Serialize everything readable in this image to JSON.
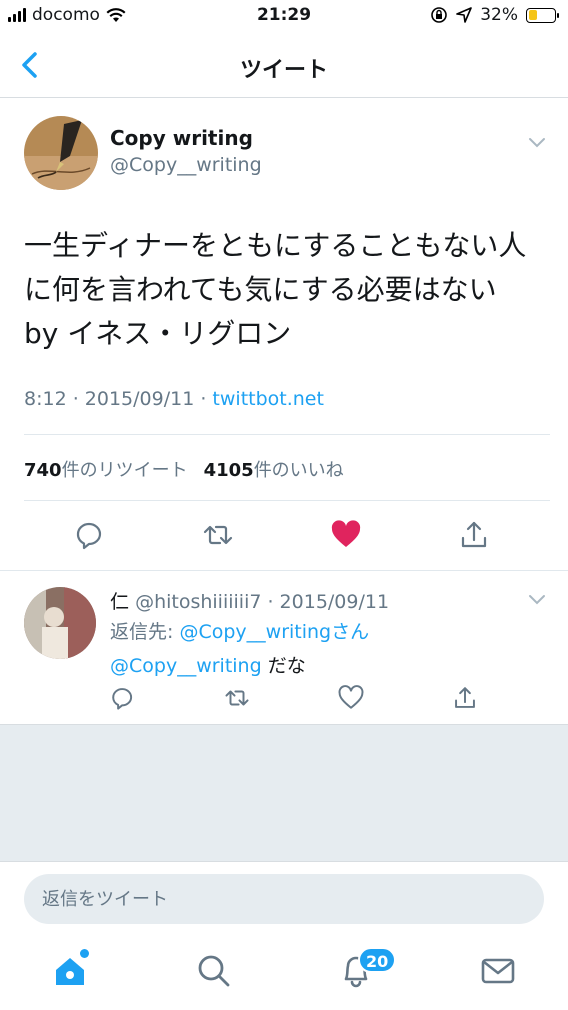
{
  "status_bar": {
    "carrier": "docomo",
    "time": "21:29",
    "battery": "32%",
    "battery_level": 0.32
  },
  "nav": {
    "title": "ツイート"
  },
  "tweet": {
    "author_name": "Copy writing",
    "author_handle": "@Copy__writing",
    "text": "一生ディナーをともにすることもない人に何を言われても気にする必要はない　by イネス・リグロン",
    "time": "8:12 · 2015/09/11 · ",
    "source": "twittbot.net",
    "retweet_count": "740",
    "retweet_label": "件のリツイート",
    "like_count": "4105",
    "like_label": "件のいいね"
  },
  "reply": {
    "name": "仁",
    "handle_date": "@hitoshiiiiiii7 · 2015/09/11",
    "reply_to_prefix": "返信先: ",
    "reply_to_handle": "@Copy__writingさん",
    "mention": "@Copy__writing",
    "text_suffix": " だな"
  },
  "composer": {
    "placeholder": "返信をツイート"
  },
  "tab_bar": {
    "notification_badge": "20"
  },
  "colors": {
    "accent": "#1da1f2",
    "like": "#e0245e",
    "secondary_text": "#657786",
    "background_gray": "#e6ecf0"
  },
  "icons": [
    "back-chevron-icon",
    "caret-down-icon",
    "reply-icon",
    "retweet-icon",
    "like-heart-icon",
    "share-icon",
    "home-icon",
    "search-icon",
    "notifications-icon",
    "messages-icon"
  ]
}
